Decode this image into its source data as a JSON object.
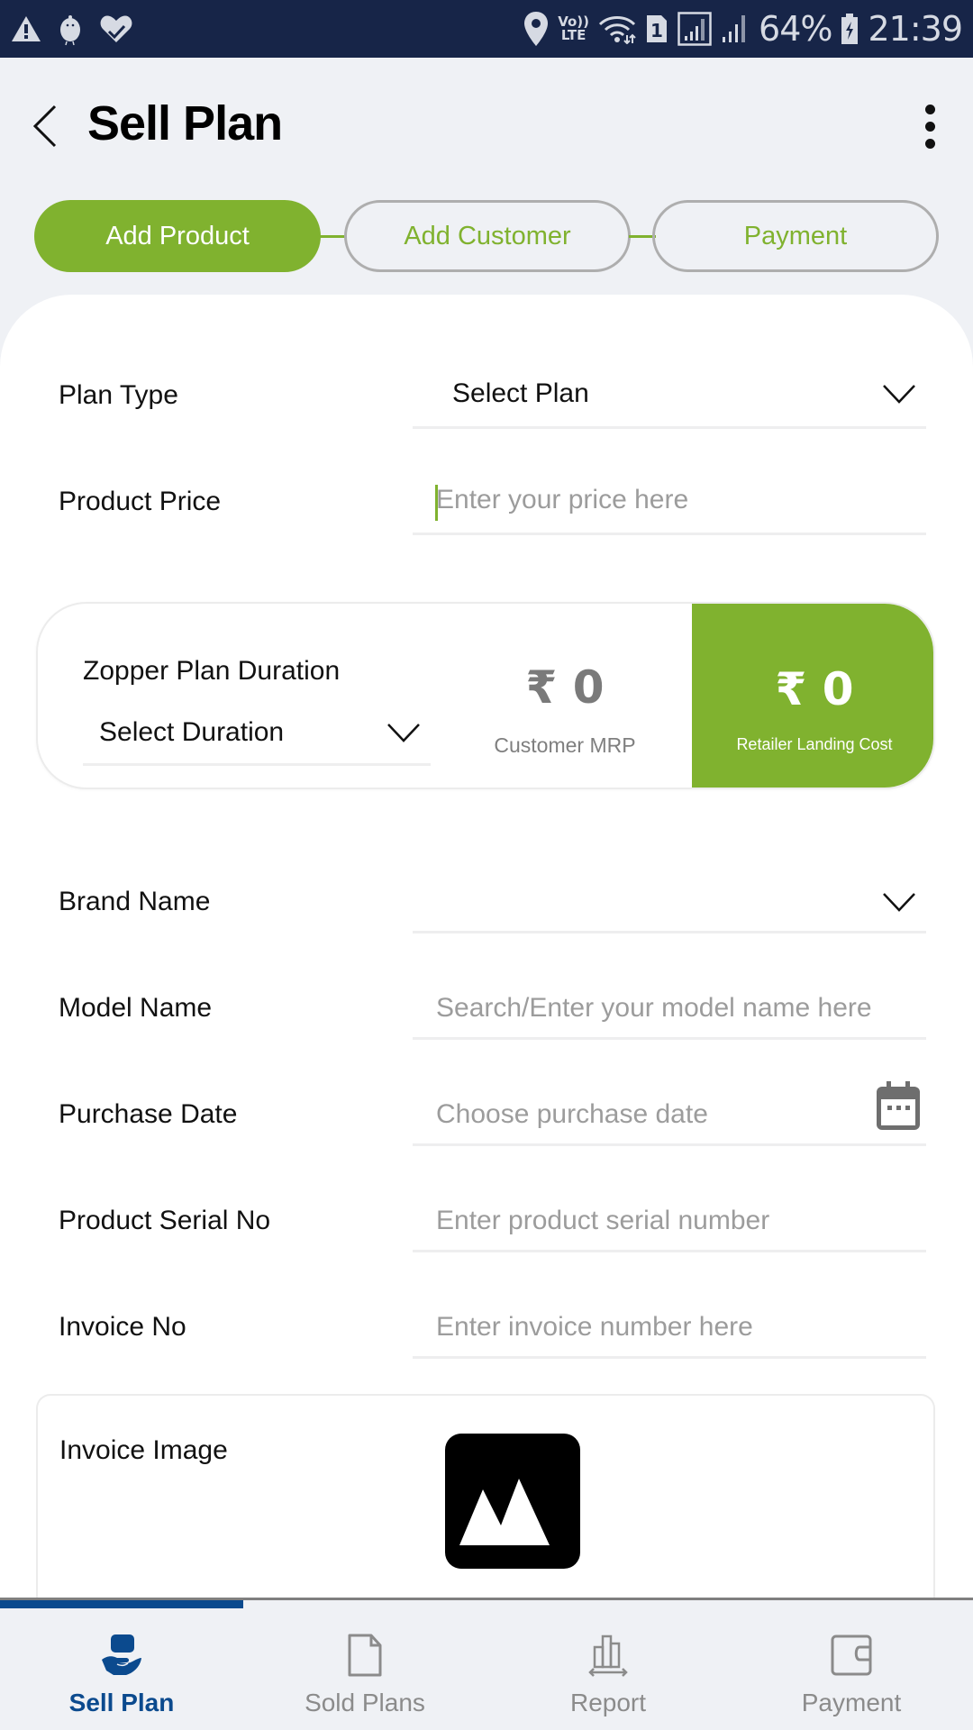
{
  "status_bar": {
    "left_icons": [
      "alert-icon",
      "bird-icon",
      "heart-check-icon"
    ],
    "right_icons": [
      "location-icon",
      "volte-icon",
      "wifi-icon",
      "sim1-icon",
      "signal-icon",
      "signal-icon-2",
      "battery-charging-icon"
    ],
    "volte_top": "Vo))",
    "volte_bottom": "LTE",
    "sim_number": "1",
    "battery": "64%",
    "time": "21:39"
  },
  "header": {
    "title": "Sell Plan",
    "back_icon": "chevron-left-icon",
    "menu_icon": "more-vert-icon"
  },
  "stepper": {
    "steps": [
      {
        "label": "Add Product",
        "active": true
      },
      {
        "label": "Add Customer",
        "active": false
      },
      {
        "label": "Payment",
        "active": false
      }
    ]
  },
  "form": {
    "plan_type": {
      "label": "Plan Type",
      "value": "Select Plan"
    },
    "product_price": {
      "label": "Product Price",
      "placeholder": "Enter your price here"
    },
    "duration": {
      "label": "Zopper Plan Duration",
      "value": "Select Duration",
      "customer_mrp": {
        "value": "₹ 0",
        "caption": "Customer MRP"
      },
      "retailer_landing_cost": {
        "value": "₹ 0",
        "caption": "Retailer Landing Cost"
      }
    },
    "brand_name": {
      "label": "Brand Name",
      "value": ""
    },
    "model_name": {
      "label": "Model Name",
      "placeholder": "Search/Enter your model name here"
    },
    "purchase_date": {
      "label": "Purchase Date",
      "placeholder": "Choose purchase date"
    },
    "serial_no": {
      "label": "Product Serial No",
      "placeholder": "Enter product serial number"
    },
    "invoice_no": {
      "label": "Invoice No",
      "placeholder": "Enter invoice number here"
    },
    "invoice_image": {
      "label": "Invoice Image"
    }
  },
  "bottom_nav": {
    "items": [
      {
        "label": "Sell Plan",
        "icon": "hand-holding-icon",
        "active": true
      },
      {
        "label": "Sold Plans",
        "icon": "document-icon",
        "active": false
      },
      {
        "label": "Report",
        "icon": "bar-chart-icon",
        "active": false
      },
      {
        "label": "Payment",
        "icon": "wallet-icon",
        "active": false
      }
    ]
  },
  "colors": {
    "brand_green": "#80b22f",
    "nav_active_blue": "#0b4a8e",
    "status_bar_bg": "#172548",
    "page_bg": "#eff1f5"
  }
}
